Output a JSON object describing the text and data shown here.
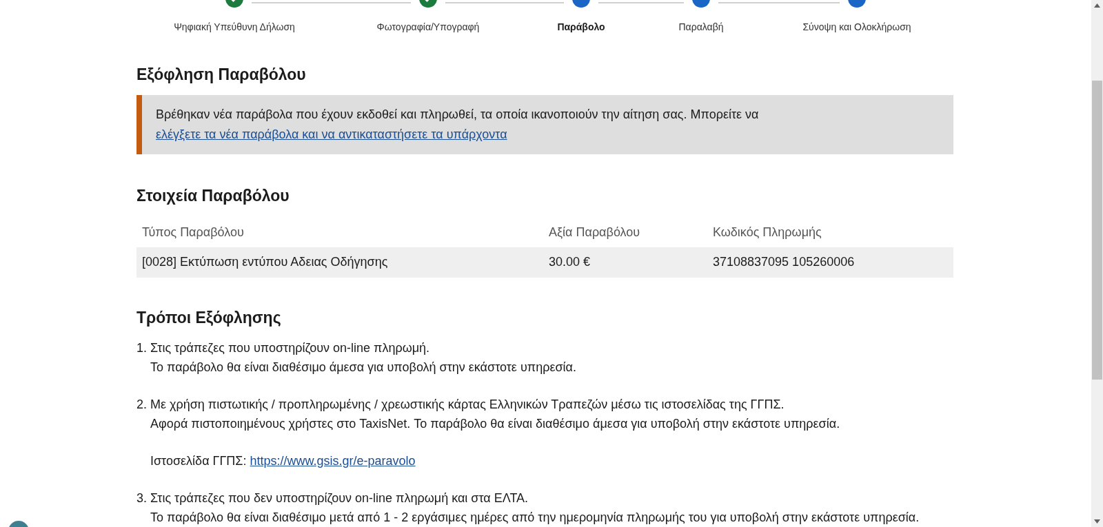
{
  "stepper": [
    {
      "label": "Ψηφιακή Υπεύθυνη Δήλωση",
      "completed": true,
      "selected": false
    },
    {
      "label": "Φωτογραφία/Υπογραφή",
      "completed": true,
      "selected": false
    },
    {
      "label": "Παράβολο",
      "completed": false,
      "selected": true
    },
    {
      "label": "Παραλαβή",
      "completed": false,
      "selected": false
    },
    {
      "label": "Σύνοψη και Ολοκλήρωση",
      "completed": false,
      "selected": false
    }
  ],
  "payment": {
    "title": "Εξόφληση Παραβόλου",
    "notice": {
      "text": "Βρέθηκαν νέα παράβολα που έχουν εκδοθεί και πληρωθεί, τα οποία ικανοποιούν την αίτηση σας. Μπορείτε να",
      "link": "ελέγξετε τα νέα παράβολα και να αντικαταστήσετε τα υπάρχοντα"
    }
  },
  "details": {
    "title": "Στοιχεία Παραβόλου",
    "columns": [
      "Τύπος Παραβόλου",
      "Αξία Παραβόλου",
      "Κωδικός Πληρωμής"
    ],
    "rows": [
      [
        "[0028] Εκτύπωση εντύπου Αδειας Οδήγησης",
        "30.00 €",
        "37108837095 105260006"
      ]
    ]
  },
  "methods": {
    "title": "Τρόποι Εξόφλησης",
    "items": [
      {
        "number": "1.",
        "title": "Στις τράπεζες που υποστηρίζουν on-line πληρωμή.",
        "description": "Το παράβολο θα είναι διαθέσιμο άμεσα για υποβολή στην εκάστοτε υπηρεσία."
      },
      {
        "number": "2.",
        "title": "Με χρήση πιστωτικής / προπληρωμένης / χρεωστικής κάρτας Ελληνικών Τραπεζών μέσω τις ιστοσελίδας της ΓΓΠΣ.",
        "description": "Αφορά πιστοποιημένους χρήστες στο TaxisNet. Το παράβολο θα είναι διαθέσιμο άμεσα για υποβολή στην εκάστοτε υπηρεσία.",
        "website_label": "Ιστοσελίδα ΓΓΠΣ:",
        "website_link": "https://www.gsis.gr/e-paravolo"
      },
      {
        "number": "3.",
        "title": "Στις τράπεζες που δεν υποστηρίζουν on-line πληρωμή και στα ΕΛΤΑ.",
        "description": "Το παράβολο θα είναι διαθέσιμο μετά από 1 - 2 εργάσιμες ημέρες από την ημερομηνία πληρωμής του για υποβολή στην εκάστοτε υπηρεσία."
      }
    ]
  }
}
